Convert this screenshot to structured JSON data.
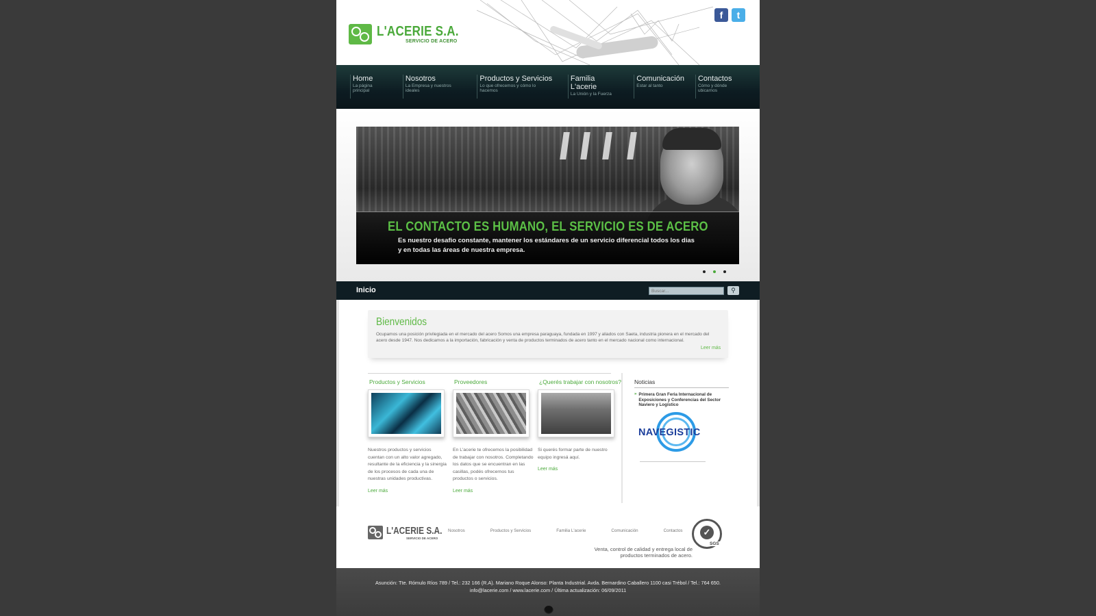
{
  "brand": {
    "name": "L'ACERIE S.A.",
    "tagline": "SERVICIO DE ACERO",
    "accent_color": "#4aa93a"
  },
  "social": [
    {
      "label": "f",
      "icon": "facebook-icon"
    },
    {
      "label": "t",
      "icon": "twitter-icon"
    }
  ],
  "nav": [
    {
      "title": "Home",
      "subtitle": "La página principal"
    },
    {
      "title": "Nosotros",
      "subtitle": "La Empresa y nuestros ideales"
    },
    {
      "title": "Productos y Servicios",
      "subtitle": "Lo que ofrecemos y cómo lo hacemos"
    },
    {
      "title": "Familia L'acerie",
      "subtitle": "La Unión y la Fuerza"
    },
    {
      "title": "Comunicación",
      "subtitle": "Estar al tanto"
    },
    {
      "title": "Contactos",
      "subtitle": "Cómo y dónde ubicarnos"
    }
  ],
  "banner": {
    "headline": "EL CONTACTO ES HUMANO, EL SERVICIO ES DE ACERO",
    "text": "Es nuestro desafio constante, mantener los estándares de un servicio diferencial todos los dias y en todas las áreas de nuestra empresa.",
    "slides": 3,
    "active_slide": 2
  },
  "bar": {
    "title": "Inicio",
    "search_placeholder": "Buscar..."
  },
  "welcome": {
    "title": "Bienvenidos",
    "text": "Ocupamos una posición privilegiada en el mercado del acero Somos una empresa paraguaya, fundada en 1997 y aliados con Saeta, industria pionera en el mercado del acero desde 1947. Nos dedicamos a la importación, fabricación y venta de productos terminados de acero tanto en el mercado nacional como internacional.",
    "more": "Leer más"
  },
  "columns": [
    {
      "title": "Productos y Servicios",
      "text": "Nuestros productos y servicios cuentan con un alto valor agregado, resultante de la eficiencia y la sinergia de los procesos de cada una de nuestras unidades productivas.",
      "more": "Leer más"
    },
    {
      "title": "Proveedores",
      "text": "En L'acerie te ofrecemos la posibilidad de trabajar con nosotros. Completando los datos que se encuentran en las casillas, podés ofrecernos tus productos o servicios.",
      "more": "Leer más"
    },
    {
      "title": "¿Querés trabajar con nosotros?",
      "text": "Si querés formar parte de nuestro equipo ingresá aquí.",
      "more": "Leer más"
    }
  ],
  "news": {
    "title": "Noticias",
    "item": "Primera Gran Feria Internacional de Exposiciones y Conferencias del Sector Naviero y Logístico",
    "logo_text": "NAVEGISTIC"
  },
  "footer": {
    "logo_name": "L'ACERIE S.A.",
    "logo_sub": "SERVICIO DE ACERO",
    "links": [
      "Nosotros",
      "Productos y Servicios",
      "Familia L'acerie",
      "Comunicación",
      "Contactos"
    ],
    "tagline": "Venta, control de calidad y entrega local de productos terminados de acero.",
    "cert": "SGS",
    "address": "Asunción: Tte. Rómulo Ríos 789 / Tel.: 232 166 (R.A). Mariano Roque Alonso: Planta Industrial. Avda. Bernardino Caballero 1100 casi Trébol / Tel.: 764 650.",
    "contact": "info@lacerie.com / www.lacerie.com / Última actualización: 06/09/2011"
  }
}
